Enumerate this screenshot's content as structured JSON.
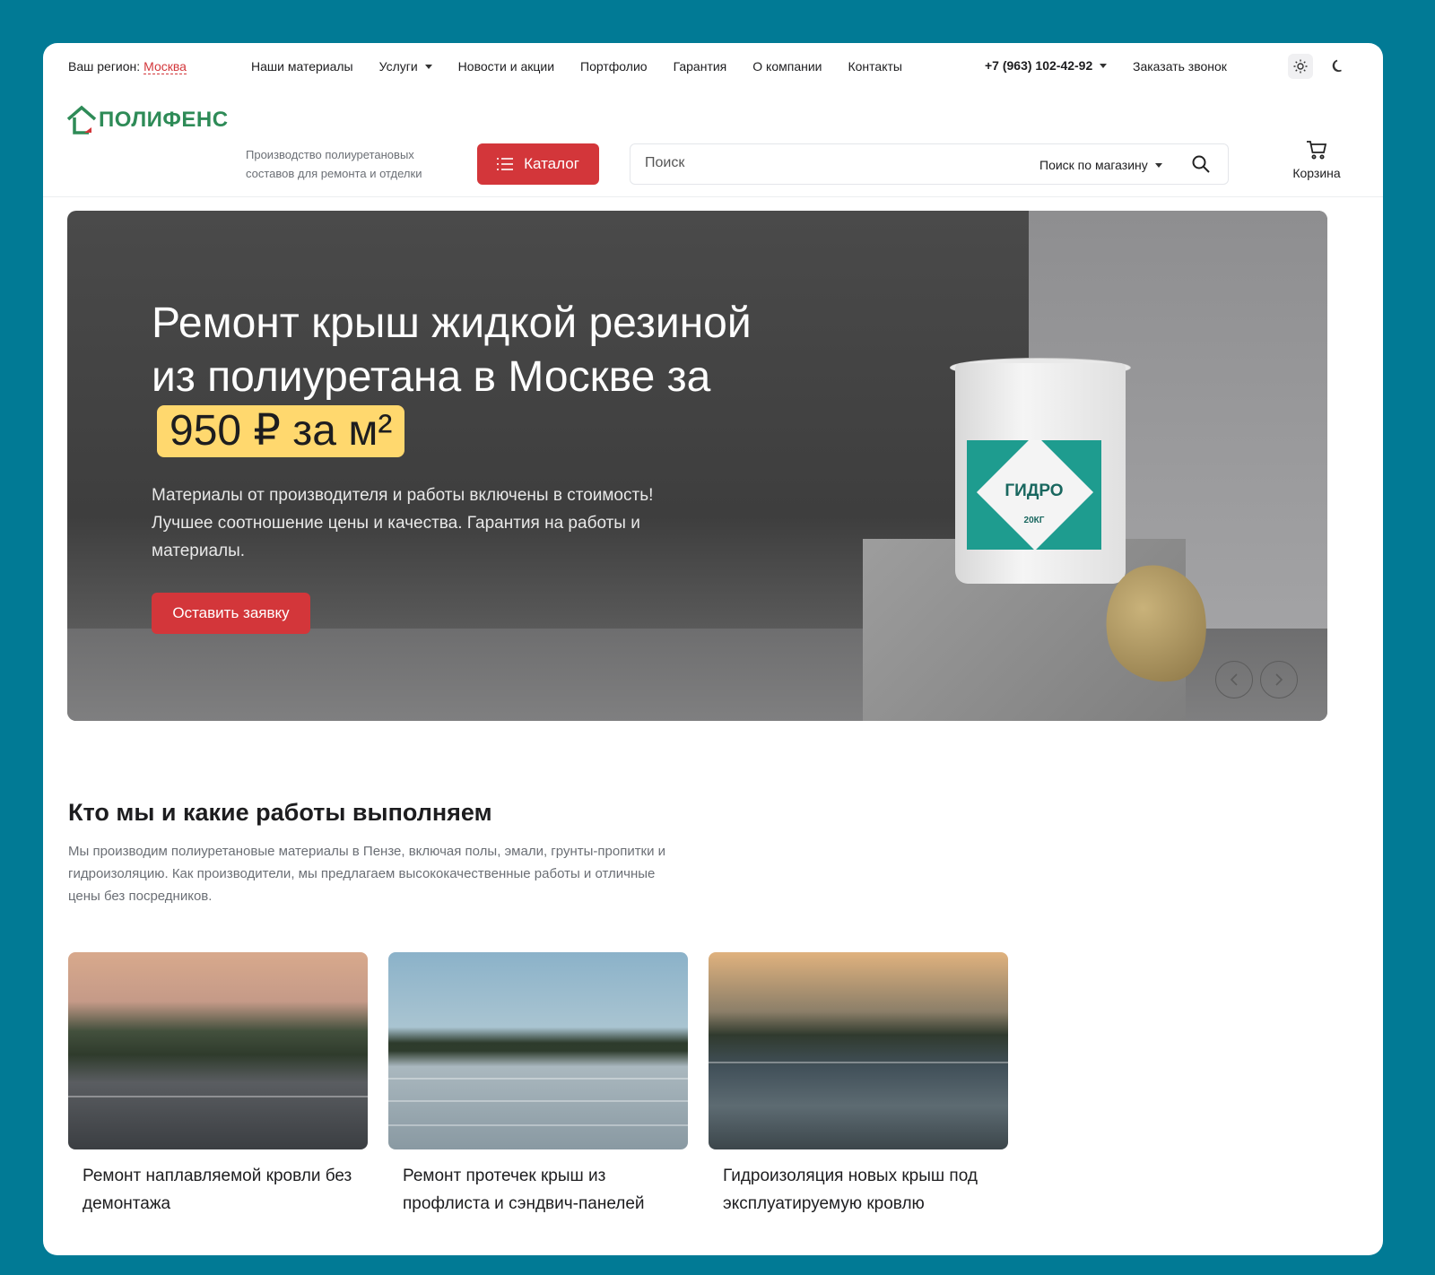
{
  "topbar": {
    "region_label": "Ваш регион:",
    "region_city": "Москва",
    "nav": [
      {
        "label": "Наши материалы",
        "has_caret": false
      },
      {
        "label": "Услуги",
        "has_caret": true
      },
      {
        "label": "Новости и акции",
        "has_caret": false
      },
      {
        "label": "Портфолио",
        "has_caret": false
      },
      {
        "label": "Гарантия",
        "has_caret": false
      },
      {
        "label": "О компании",
        "has_caret": false
      },
      {
        "label": "Контакты",
        "has_caret": false
      }
    ],
    "phone": "+7 (963) 102-42-92",
    "callback": "Заказать звонок",
    "icons": {
      "light": "sun-icon",
      "dark": "moon-icon"
    }
  },
  "header": {
    "logo_text": "ПОЛИФЕНС",
    "tagline": "Производство полиуретановых составов для ремонта и отделки",
    "catalog_label": "Каталог",
    "search_placeholder": "Поиск",
    "search_scope": "Поиск по магазину",
    "cart_label": "Корзина"
  },
  "hero": {
    "title_line": "Ремонт крыш жидкой резиной из полиуретана в Москве за",
    "price": "950 ₽ за м²",
    "subtitle": "Материалы от производителя и работы включены в стоимость! Лучшее соотношение цены и качества. Гарантия на работы и материалы.",
    "cta": "Оставить заявку",
    "product_brand": "ГИДРО",
    "product_weight": "20КГ"
  },
  "about": {
    "title": "Кто мы и какие работы выполняем",
    "text": "Мы производим полиуретановые материалы в Пензе, включая полы, эмали, грунты-пропитки и гидроизоляцию. Как производители, мы предлагаем высококачественные работы и отличные цены без посредников.",
    "cards": [
      {
        "caption": "Ремонт наплавляемой кровли без демонтажа"
      },
      {
        "caption": "Ремонт протечек крыш из профлиста и сэндвич-панелей"
      },
      {
        "caption": "Гидроизоляция новых крыш под эксплуатируемую кровлю"
      }
    ]
  },
  "colors": {
    "accent": "#d3363a",
    "price_badge": "#ffd86e",
    "brand_green": "#2e8b57",
    "page_bg": "#017a95"
  }
}
